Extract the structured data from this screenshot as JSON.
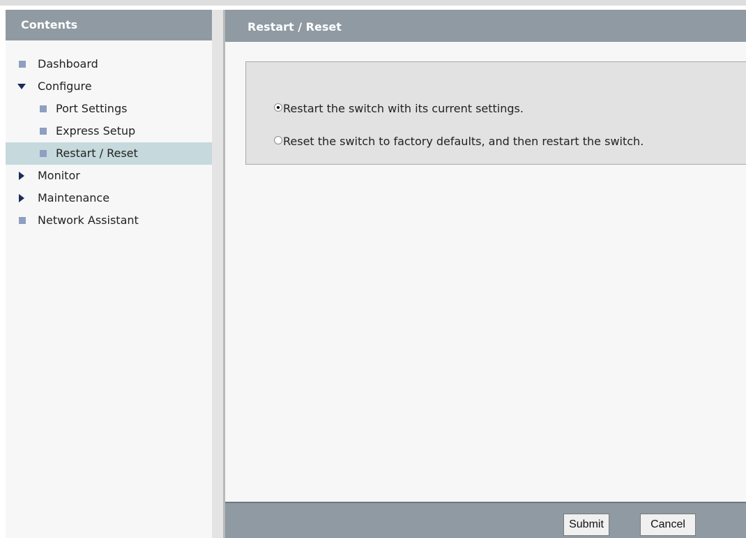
{
  "sidebar": {
    "title": "Contents",
    "items": [
      {
        "label": "Dashboard"
      },
      {
        "label": "Configure"
      },
      {
        "label": "Port Settings"
      },
      {
        "label": "Express Setup"
      },
      {
        "label": "Restart / Reset"
      },
      {
        "label": "Monitor"
      },
      {
        "label": "Maintenance"
      },
      {
        "label": "Network Assistant"
      }
    ]
  },
  "main": {
    "title": "Restart / Reset",
    "options": [
      {
        "label": "Restart the switch with its current settings.",
        "selected": true
      },
      {
        "label": "Reset the switch to factory defaults, and then restart the switch.",
        "selected": false
      }
    ]
  },
  "footer": {
    "submit_label": "Submit",
    "cancel_label": "Cancel"
  },
  "colors": {
    "header_bar": "#8f9aa2",
    "selected_item": "#c6d9dc",
    "bullet": "#8f9fc2",
    "arrow": "#1d2a5c"
  }
}
